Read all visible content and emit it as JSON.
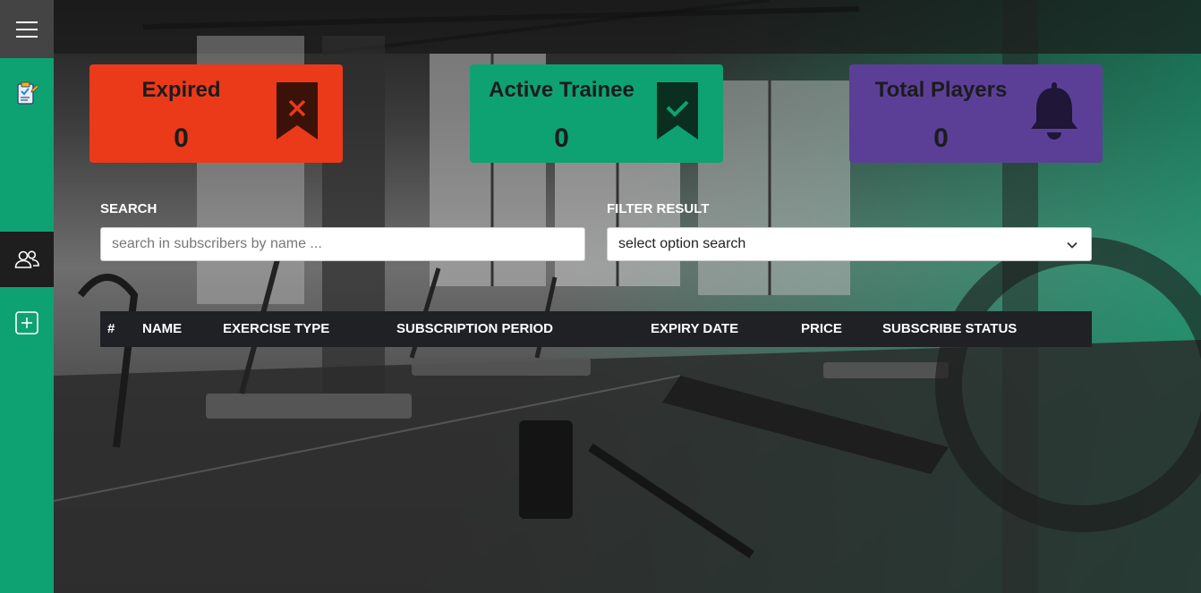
{
  "sidebar": {
    "menu_icon": "hamburger-icon",
    "items": [
      {
        "icon": "clipboard-check-icon",
        "active": false
      },
      {
        "icon": "users-icon",
        "active": true
      },
      {
        "icon": "add-square-icon",
        "active": false
      }
    ]
  },
  "cards": {
    "expired": {
      "title": "Expired",
      "value": "0",
      "icon": "bookmark-x-icon",
      "color": "#ea3a1a"
    },
    "active": {
      "title": "Active Trainee",
      "value": "0",
      "icon": "bookmark-check-icon",
      "color": "#0ea272"
    },
    "total": {
      "title": "Total Players",
      "value": "0",
      "icon": "bell-icon",
      "color": "#5b3f97"
    }
  },
  "search": {
    "label": "SEARCH",
    "placeholder": "search in subscribers by name ..."
  },
  "filter": {
    "label": "FILTER RESULT",
    "selected": "select option search"
  },
  "table": {
    "columns": [
      "#",
      "NAME",
      "EXERCISE TYPE",
      "SUBSCRIPTION PERIOD",
      "EXPIRY DATE",
      "PRICE",
      "SUBSCRIBE STATUS"
    ],
    "rows": []
  },
  "colors": {
    "accent_green": "#0ea272",
    "expired_red": "#ea3a1a",
    "players_purple": "#5b3f97",
    "table_header": "#1f2125"
  }
}
